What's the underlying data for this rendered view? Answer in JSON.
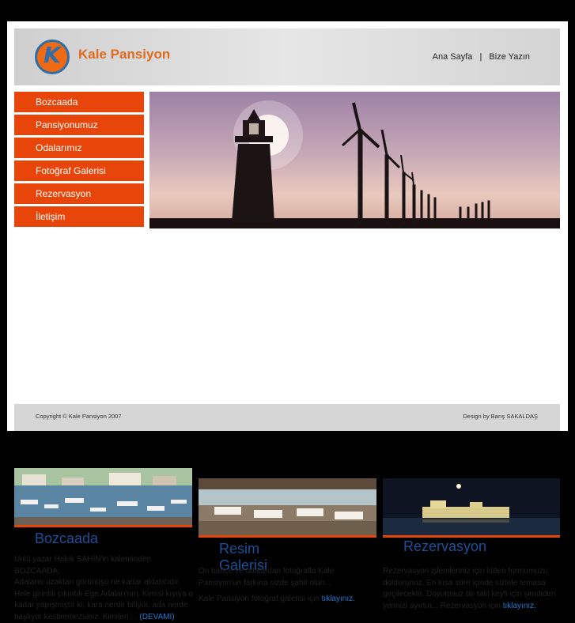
{
  "header": {
    "logo_text": "Kale Pansiyon",
    "nav": [
      {
        "label": "Ana Sayfa"
      },
      {
        "label": "Bize Yazın"
      }
    ],
    "nav_separator": "|"
  },
  "menu": [
    {
      "label": "Bozcaada"
    },
    {
      "label": "Pansiyonumuz"
    },
    {
      "label": "Odalarımız"
    },
    {
      "label": "Fotoğraf Galerisi"
    },
    {
      "label": "Rezervasyon"
    },
    {
      "label": "İletişim"
    }
  ],
  "columns": [
    {
      "title": "Bozcaada",
      "text_1": "Ünlü yazar Haluk SAHİN'in kaleminden BOZCAADA;",
      "text_2": "Adaların uzaktan görünüşü ne kadar aldatıcıdır. Hele girintili çıkıntılı Ege Adaları'nın. Kimisi kıyıya o kadar yapışmıştır ki, kara nerde bitiyor, ada nerde başlıyor kestiremezsiniz. Kimileri ... ",
      "link": "(DEVAMI)"
    },
    {
      "title": "Resim Galerisi",
      "text_1": "Ön bahçe ve odalardan fotoğrafla Kale Pansiyon'un farkına sizde şahit olun...",
      "text_2": "Kale Pansiyon fotoğraf galerisi için ",
      "link": "tıklayınız."
    },
    {
      "title": "Rezervasyon",
      "text_1": "Rezervasyon işlemleriniz için lütfen formumuzu doldurunuz. En kısa süre içinde sizinle temasa geçilecektir. Doyumsuz bir tatil keyfi için şimdiden yerinizi ayırtın... Rezervasyon için ",
      "link": "tıklayınız."
    }
  ],
  "footer": {
    "copyright": "Copyright © Kale Pansiyon 2007",
    "design": "Design by Barış SAKALDAŞ"
  },
  "colors": {
    "accent": "#e8450a",
    "title_blue": "#1d4f9a",
    "link_blue": "#1d7ad1"
  }
}
